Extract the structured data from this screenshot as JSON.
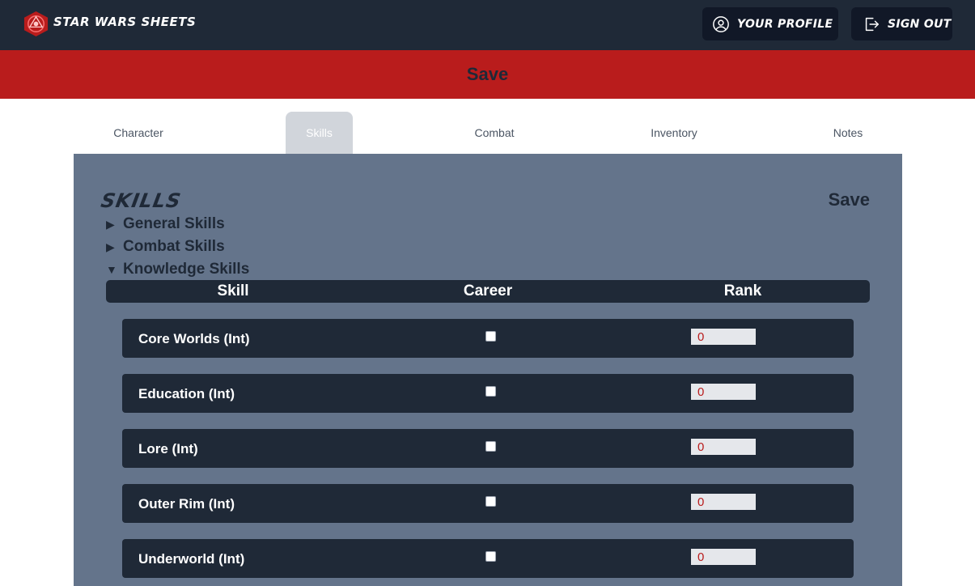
{
  "app": {
    "brand": "STAR WARS SHEETS"
  },
  "topnav": {
    "profile_label": "YOUR PROFILE",
    "signout_label": "SIGN OUT"
  },
  "savebar": {
    "label": "Save"
  },
  "tabs": [
    {
      "label": "Character",
      "active": false
    },
    {
      "label": "Skills",
      "active": true
    },
    {
      "label": "Combat",
      "active": false
    },
    {
      "label": "Inventory",
      "active": false
    },
    {
      "label": "Notes",
      "active": false
    }
  ],
  "panel": {
    "title": "SKILLS",
    "save_label": "Save",
    "groups": [
      {
        "label": "General Skills",
        "expanded": false
      },
      {
        "label": "Combat Skills",
        "expanded": false
      },
      {
        "label": "Knowledge Skills",
        "expanded": true
      }
    ],
    "columns": [
      "Skill",
      "Career",
      "Rank"
    ],
    "rows": [
      {
        "skill": "Core Worlds (Int)",
        "career": false,
        "rank": "0"
      },
      {
        "skill": "Education (Int)",
        "career": false,
        "rank": "0"
      },
      {
        "skill": "Lore (Int)",
        "career": false,
        "rank": "0"
      },
      {
        "skill": "Outer Rim (Int)",
        "career": false,
        "rank": "0"
      },
      {
        "skill": "Underworld (Int)",
        "career": false,
        "rank": "0"
      }
    ]
  },
  "colors": {
    "topbar": "#1f2937",
    "accent": "#b91c1c",
    "panel": "#64748b",
    "row": "#1f2937"
  }
}
